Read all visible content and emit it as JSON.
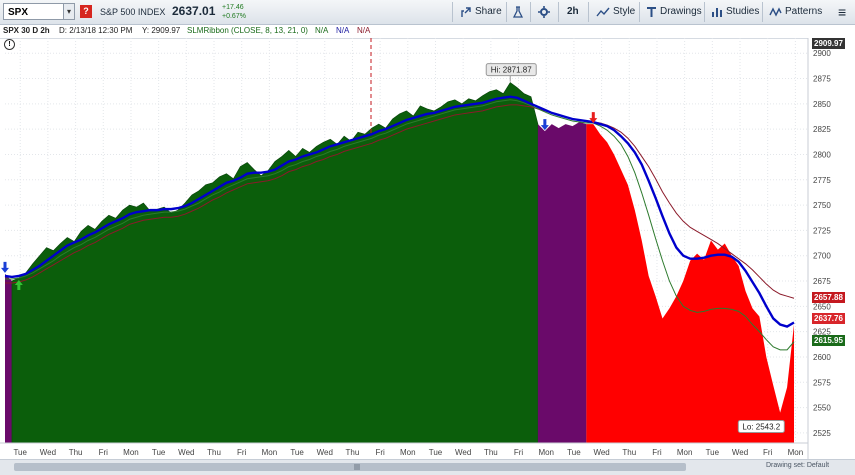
{
  "toolbar": {
    "symbol": "SPX",
    "flag_label": "?",
    "symbol_name": "S&P 500 INDEX",
    "last_price": "2637.01",
    "change_abs": "+17.46",
    "change_pct": "+0.67%",
    "share_label": "Share",
    "interval_label": "2h",
    "style_label": "Style",
    "drawings_label": "Drawings",
    "studies_label": "Studies",
    "patterns_label": "Patterns"
  },
  "infobar": {
    "chart_id": "SPX 30 D 2h",
    "date": "D: 2/13/18 12:30 PM",
    "y_value": "Y: 2909.97",
    "study": "SLMRibbon (CLOSE, 8, 13, 21, 0)",
    "na1": "N/A",
    "na2": "N/A",
    "na3": "N/A"
  },
  "price_tags": {
    "cursor": "2909.97",
    "tag_red": "2657.88",
    "tag_blue": "2637.76",
    "tag_green": "2615.95"
  },
  "colors": {
    "up": "#0b5e0b",
    "up_edge": "#07420a",
    "neutral": "#6a0a6a",
    "down": "#ff0000",
    "fast_line": "#0000cc",
    "mid_line": "#2d7a2d",
    "slow_line": "#8b1a2a",
    "tag_red": "#c4191f",
    "tag_blue": "#d8262b",
    "tag_green": "#1a6b1a"
  },
  "bottom_bar": {
    "drawing_set": "Drawing set: Default"
  },
  "chart_data": {
    "type": "area",
    "title": "SPX 30 D 2h",
    "y_axis_ticks": [
      2900,
      2875,
      2850,
      2825,
      2800,
      2775,
      2750,
      2725,
      2700,
      2675,
      2650,
      2625,
      2600,
      2575,
      2550,
      2525
    ],
    "ylim": [
      2515,
      2915
    ],
    "x_tick_labels": [
      "Tue",
      "Wed",
      "Thu",
      "Fri",
      "Mon",
      "Tue",
      "Wed",
      "Thu",
      "Fri",
      "Mon",
      "Tue",
      "Wed",
      "Thu",
      "Fri",
      "Mon",
      "Tue",
      "Wed",
      "Thu",
      "Fri",
      "Mon",
      "Tue",
      "Wed",
      "Thu",
      "Fri",
      "Mon",
      "Tue",
      "Wed",
      "Fri",
      "Mon"
    ],
    "x_tick_index": [
      2.2,
      6.2,
      10.2,
      14.2,
      18.2,
      22.2,
      26.2,
      30.2,
      34.2,
      38.2,
      42.2,
      46.2,
      50.2,
      54.2,
      58.2,
      62.2,
      66.2,
      70.2,
      74.2,
      78.2,
      82.2,
      86.2,
      90.2,
      94.2,
      98.2,
      102.2,
      106.2,
      110.2,
      114.2
    ],
    "annotations": {
      "high": {
        "label": "Hi: 2871.87",
        "value": 2871.87,
        "index": 73
      },
      "low": {
        "label": "Lo: 2543.2",
        "value": 2543.2,
        "index": 110
      }
    },
    "signals": [
      {
        "index": 0,
        "type": "down",
        "color": "#1a3fd6"
      },
      {
        "index": 2,
        "type": "up",
        "color": "#34c234"
      },
      {
        "index": 78,
        "type": "down",
        "color": "#1a3fd6"
      },
      {
        "index": 85,
        "type": "down",
        "color": "#e81d1d"
      }
    ],
    "segments": [
      {
        "name": "",
        "state": "neutral",
        "from": 0,
        "to": 1
      },
      {
        "name": "",
        "state": "up",
        "from": 1,
        "to": 77
      },
      {
        "name": "",
        "state": "neutral",
        "from": 77,
        "to": 84
      },
      {
        "name": "",
        "state": "down",
        "from": 84,
        "to": 114
      }
    ],
    "series": [
      {
        "name": "",
        "role": "close",
        "values": [
          2682,
          2675,
          2678,
          2683,
          2692,
          2700,
          2708,
          2705,
          2712,
          2718,
          2714,
          2724,
          2730,
          2726,
          2734,
          2740,
          2737,
          2745,
          2750,
          2748,
          2752,
          2744,
          2746,
          2748,
          2742,
          2745,
          2752,
          2760,
          2764,
          2770,
          2772,
          2778,
          2781,
          2776,
          2788,
          2792,
          2785,
          2779,
          2784,
          2793,
          2798,
          2804,
          2798,
          2806,
          2802,
          2808,
          2812,
          2815,
          2810,
          2818,
          2813,
          2822,
          2820,
          2826,
          2830,
          2826,
          2835,
          2840,
          2843,
          2838,
          2848,
          2845,
          2843,
          2847,
          2852,
          2854,
          2850,
          2855,
          2853,
          2858,
          2862,
          2864,
          2860,
          2871,
          2866,
          2860,
          2857,
          2830,
          2823,
          2830,
          2826,
          2830,
          2828,
          2832,
          2830,
          2830,
          2820,
          2812,
          2800,
          2785,
          2770,
          2745,
          2715,
          2680,
          2660,
          2638,
          2648,
          2660,
          2675,
          2695,
          2702,
          2696,
          2715,
          2706,
          2712,
          2700,
          2690,
          2665,
          2648,
          2640,
          2600,
          2572,
          2545,
          2570,
          2632
        ]
      },
      {
        "name": "",
        "role": "ema-fast",
        "values": [
          2680,
          2679,
          2680,
          2682,
          2686,
          2690,
          2695,
          2700,
          2705,
          2710,
          2713,
          2716,
          2720,
          2723,
          2727,
          2731,
          2734,
          2737,
          2741,
          2743,
          2744,
          2745,
          2745,
          2746,
          2746,
          2747,
          2749,
          2752,
          2756,
          2760,
          2764,
          2768,
          2772,
          2774,
          2777,
          2781,
          2782,
          2782,
          2783,
          2785,
          2789,
          2793,
          2795,
          2798,
          2800,
          2802,
          2805,
          2808,
          2810,
          2812,
          2814,
          2816,
          2818,
          2820,
          2823,
          2825,
          2828,
          2831,
          2834,
          2836,
          2838,
          2840,
          2841,
          2843,
          2845,
          2847,
          2848,
          2849,
          2850,
          2851,
          2853,
          2855,
          2856,
          2857,
          2856,
          2853,
          2850,
          2847,
          2844,
          2841,
          2839,
          2837,
          2835,
          2834,
          2833,
          2832,
          2830,
          2828,
          2824,
          2818,
          2811,
          2802,
          2790,
          2774,
          2757,
          2739,
          2722,
          2708,
          2700,
          2697,
          2697,
          2698,
          2700,
          2701,
          2701,
          2699,
          2694,
          2685,
          2674,
          2663,
          2650,
          2638,
          2632,
          2630,
          2634
        ]
      },
      {
        "name": "",
        "role": "ema-mid",
        "values": [
          2677,
          2677,
          2678,
          2680,
          2683,
          2687,
          2691,
          2695,
          2700,
          2704,
          2708,
          2711,
          2715,
          2718,
          2722,
          2726,
          2729,
          2732,
          2736,
          2738,
          2740,
          2741,
          2742,
          2743,
          2743,
          2744,
          2746,
          2749,
          2752,
          2756,
          2760,
          2763,
          2767,
          2770,
          2773,
          2776,
          2777,
          2778,
          2779,
          2781,
          2784,
          2788,
          2790,
          2793,
          2795,
          2798,
          2800,
          2803,
          2805,
          2808,
          2810,
          2812,
          2814,
          2816,
          2819,
          2821,
          2824,
          2827,
          2830,
          2832,
          2834,
          2836,
          2838,
          2840,
          2842,
          2844,
          2845,
          2846,
          2847,
          2848,
          2850,
          2852,
          2853,
          2854,
          2853,
          2851,
          2848,
          2845,
          2842,
          2839,
          2837,
          2835,
          2833,
          2832,
          2831,
          2831,
          2828,
          2824,
          2818,
          2810,
          2798,
          2782,
          2762,
          2740,
          2717,
          2695,
          2675,
          2660,
          2650,
          2646,
          2644,
          2645,
          2647,
          2648,
          2648,
          2647,
          2645,
          2640,
          2632,
          2625,
          2617,
          2610,
          2607,
          2607,
          2615
        ]
      },
      {
        "name": "",
        "role": "ema-slow",
        "values": [
          2673,
          2673,
          2674,
          2676,
          2679,
          2683,
          2687,
          2691,
          2695,
          2699,
          2703,
          2706,
          2710,
          2713,
          2717,
          2721,
          2724,
          2727,
          2731,
          2733,
          2735,
          2736,
          2737,
          2738,
          2738,
          2739,
          2741,
          2744,
          2747,
          2751,
          2755,
          2758,
          2762,
          2765,
          2768,
          2771,
          2772,
          2773,
          2774,
          2776,
          2779,
          2783,
          2785,
          2788,
          2790,
          2793,
          2795,
          2798,
          2800,
          2803,
          2805,
          2807,
          2809,
          2811,
          2814,
          2816,
          2819,
          2822,
          2825,
          2827,
          2829,
          2831,
          2833,
          2835,
          2837,
          2839,
          2840,
          2841,
          2842,
          2843,
          2845,
          2847,
          2848,
          2849,
          2849,
          2848,
          2847,
          2845,
          2843,
          2841,
          2839,
          2837,
          2835,
          2834,
          2833,
          2832,
          2831,
          2829,
          2826,
          2822,
          2816,
          2808,
          2798,
          2788,
          2776,
          2763,
          2752,
          2742,
          2734,
          2728,
          2724,
          2720,
          2716,
          2712,
          2707,
          2702,
          2697,
          2692,
          2686,
          2679,
          2672,
          2666,
          2662,
          2660,
          2658
        ]
      }
    ]
  }
}
